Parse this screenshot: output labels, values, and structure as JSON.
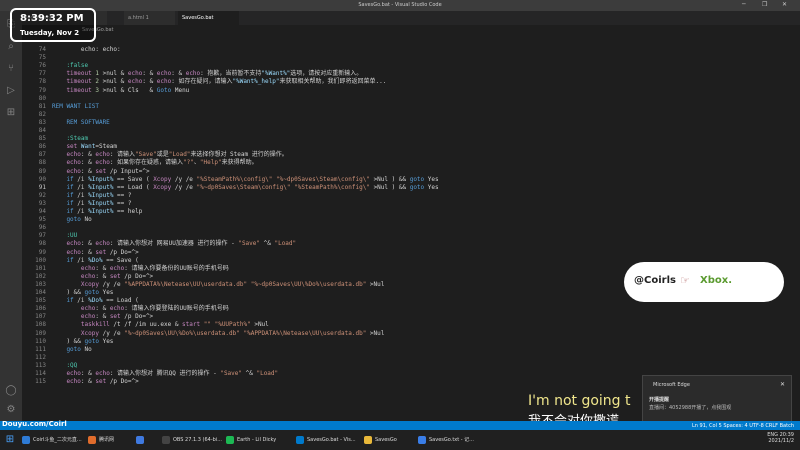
{
  "window": {
    "title": "SavesGo.bat - Visual Studio Code",
    "controls": [
      "─",
      "❐",
      "✕"
    ]
  },
  "tabs": [
    {
      "label": "login.html"
    },
    {
      "label": "a.html 1"
    },
    {
      "label": "SavesGo.bat",
      "active": true
    }
  ],
  "breadcrumb": "SavesGo.bat",
  "activity_icons": [
    "files-icon",
    "search-icon",
    "source-control-icon",
    "run-debug-icon",
    "extensions-icon"
  ],
  "activity_glyphs": [
    "⎘",
    "⌕",
    "⑂",
    "▷",
    "⊞"
  ],
  "bottom_icons": [
    "account-icon",
    "settings-gear-icon"
  ],
  "bottom_glyphs": [
    "◯",
    "⚙"
  ],
  "lines": [
    {
      "n": "74",
      "parts": [
        [
          "txt",
          "        echo: echo:"
        ]
      ]
    },
    {
      "n": "75",
      "parts": []
    },
    {
      "n": "76",
      "parts": [
        [
          "lbl",
          "    :false"
        ]
      ]
    },
    {
      "n": "77",
      "parts": [
        [
          "cmd",
          "    timeout "
        ],
        [
          "num",
          "1"
        ],
        [
          "txt",
          " >nul & "
        ],
        [
          "cmd",
          "echo"
        ],
        [
          "txt",
          ": & "
        ],
        [
          "cmd",
          "echo"
        ],
        [
          "txt",
          ": & "
        ],
        [
          "cmd",
          "echo"
        ],
        [
          "txt",
          ": 抱歉，当前暂不支持"
        ],
        [
          "var",
          "\"%Want%\""
        ],
        [
          "txt",
          "选项，请按对应重新输入。"
        ]
      ]
    },
    {
      "n": "78",
      "parts": [
        [
          "cmd",
          "    timeout "
        ],
        [
          "num",
          "2"
        ],
        [
          "txt",
          " >nul & "
        ],
        [
          "cmd",
          "echo"
        ],
        [
          "txt",
          ": & "
        ],
        [
          "cmd",
          "echo"
        ],
        [
          "txt",
          ": 如存在疑问，请输入"
        ],
        [
          "var",
          "\"%Want%_help\""
        ],
        [
          "txt",
          "来获取相关帮助，我们即将返回菜单..."
        ]
      ]
    },
    {
      "n": "79",
      "parts": [
        [
          "cmd",
          "    timeout "
        ],
        [
          "num",
          "3"
        ],
        [
          "txt",
          " >nul & Cls   & "
        ],
        [
          "kw",
          "Goto"
        ],
        [
          "txt",
          " Menu"
        ]
      ]
    },
    {
      "n": "80",
      "parts": []
    },
    {
      "n": "81",
      "parts": [
        [
          "kw",
          "REM WANT LIST"
        ]
      ]
    },
    {
      "n": "82",
      "parts": []
    },
    {
      "n": "83",
      "parts": [
        [
          "kw",
          "    REM SOFTWARE"
        ]
      ]
    },
    {
      "n": "84",
      "parts": []
    },
    {
      "n": "85",
      "parts": [
        [
          "lbl",
          "    :Steam"
        ]
      ]
    },
    {
      "n": "86",
      "parts": [
        [
          "cmd",
          "    set "
        ],
        [
          "var",
          "Want"
        ],
        [
          "txt",
          "=Steam"
        ]
      ]
    },
    {
      "n": "87",
      "parts": [
        [
          "cmd",
          "    echo"
        ],
        [
          "txt",
          ": & "
        ],
        [
          "cmd",
          "echo"
        ],
        [
          "txt",
          ": 请输入"
        ],
        [
          "str",
          "\"Save\""
        ],
        [
          "txt",
          "或是"
        ],
        [
          "str",
          "\"Load\""
        ],
        [
          "txt",
          "来选择你想对 Steam 进行的操作。"
        ]
      ]
    },
    {
      "n": "88",
      "parts": [
        [
          "cmd",
          "    echo"
        ],
        [
          "txt",
          ": & "
        ],
        [
          "cmd",
          "echo"
        ],
        [
          "txt",
          ": 如果你存在疑惑，请输入"
        ],
        [
          "str",
          "\"?\""
        ],
        [
          "txt",
          "、"
        ],
        [
          "str",
          "\"Help\""
        ],
        [
          "txt",
          "来获得帮助。"
        ]
      ]
    },
    {
      "n": "89",
      "parts": [
        [
          "cmd",
          "    echo"
        ],
        [
          "txt",
          ": & "
        ],
        [
          "cmd",
          "set"
        ],
        [
          "txt",
          " /p Input=^>"
        ]
      ]
    },
    {
      "n": "90",
      "parts": [
        [
          "kw",
          "    if"
        ],
        [
          "txt",
          " /i "
        ],
        [
          "var",
          "%Input%"
        ],
        [
          "txt",
          " == Save ( "
        ],
        [
          "cmd",
          "Xcopy"
        ],
        [
          "txt",
          " /y /e "
        ],
        [
          "str",
          "\"%SteamPath%\\config\\\""
        ],
        [
          "txt",
          " "
        ],
        [
          "str",
          "\"%~dp0Saves\\Steam\\config\\\""
        ],
        [
          "txt",
          " >Nul ) && "
        ],
        [
          "kw",
          "goto"
        ],
        [
          "txt",
          " Yes"
        ]
      ]
    },
    {
      "n": "91",
      "parts": [
        [
          "kw",
          "    if"
        ],
        [
          "txt",
          " /i "
        ],
        [
          "var",
          "%Input%"
        ],
        [
          "txt",
          " == Load ( "
        ],
        [
          "cmd",
          "Xcopy"
        ],
        [
          "txt",
          " /y /e "
        ],
        [
          "str",
          "\"%~dp0Saves\\Steam\\config\\\""
        ],
        [
          "txt",
          " "
        ],
        [
          "str",
          "\"%SteamPath%\\config\\\""
        ],
        [
          "txt",
          " >Nul ) && "
        ],
        [
          "kw",
          "goto"
        ],
        [
          "txt",
          " Yes"
        ]
      ]
    },
    {
      "n": "92",
      "parts": [
        [
          "kw",
          "    if"
        ],
        [
          "txt",
          " /i "
        ],
        [
          "var",
          "%Input%"
        ],
        [
          "txt",
          " == ?"
        ]
      ]
    },
    {
      "n": "93",
      "parts": [
        [
          "kw",
          "    if"
        ],
        [
          "txt",
          " /i "
        ],
        [
          "var",
          "%Input%"
        ],
        [
          "txt",
          " == ?"
        ]
      ]
    },
    {
      "n": "94",
      "parts": [
        [
          "kw",
          "    if"
        ],
        [
          "txt",
          " /i "
        ],
        [
          "var",
          "%Input%"
        ],
        [
          "txt",
          " == help"
        ]
      ]
    },
    {
      "n": "95",
      "parts": [
        [
          "kw",
          "    goto"
        ],
        [
          "txt",
          " No"
        ]
      ]
    },
    {
      "n": "96",
      "parts": []
    },
    {
      "n": "97",
      "parts": [
        [
          "lbl",
          "    :UU"
        ]
      ]
    },
    {
      "n": "98",
      "parts": [
        [
          "cmd",
          "    echo"
        ],
        [
          "txt",
          ": & "
        ],
        [
          "cmd",
          "echo"
        ],
        [
          "txt",
          ": 请输入你想对 网易UU加速器 进行的操作 - "
        ],
        [
          "str",
          "\"Save\""
        ],
        [
          "txt",
          " ^& "
        ],
        [
          "str",
          "\"Load\""
        ]
      ]
    },
    {
      "n": "99",
      "parts": [
        [
          "cmd",
          "    echo"
        ],
        [
          "txt",
          ": & "
        ],
        [
          "cmd",
          "set"
        ],
        [
          "txt",
          " /p Do=^>"
        ]
      ]
    },
    {
      "n": "100",
      "parts": [
        [
          "kw",
          "    if"
        ],
        [
          "txt",
          " /i "
        ],
        [
          "var",
          "%Do%"
        ],
        [
          "txt",
          " == Save ("
        ]
      ]
    },
    {
      "n": "101",
      "parts": [
        [
          "cmd",
          "        echo"
        ],
        [
          "txt",
          ": & "
        ],
        [
          "cmd",
          "echo"
        ],
        [
          "txt",
          ": 请输入你要备份的UU账号的手机号码"
        ]
      ]
    },
    {
      "n": "102",
      "parts": [
        [
          "cmd",
          "        echo"
        ],
        [
          "txt",
          ": & "
        ],
        [
          "cmd",
          "set"
        ],
        [
          "txt",
          " /p Do=^>"
        ]
      ]
    },
    {
      "n": "103",
      "parts": [
        [
          "cmd",
          "        Xcopy"
        ],
        [
          "txt",
          " /y /e "
        ],
        [
          "str",
          "\"%APPDATA%\\Netease\\UU\\userdata.db\""
        ],
        [
          "txt",
          " "
        ],
        [
          "str",
          "\"%~dp0Saves\\UU\\%Do%\\userdata.db\""
        ],
        [
          "txt",
          " >Nul"
        ]
      ]
    },
    {
      "n": "104",
      "parts": [
        [
          "txt",
          "    ) && "
        ],
        [
          "kw",
          "goto"
        ],
        [
          "txt",
          " Yes"
        ]
      ]
    },
    {
      "n": "105",
      "parts": [
        [
          "kw",
          "    if"
        ],
        [
          "txt",
          " /i "
        ],
        [
          "var",
          "%Do%"
        ],
        [
          "txt",
          " == Load ("
        ]
      ]
    },
    {
      "n": "106",
      "parts": [
        [
          "cmd",
          "        echo"
        ],
        [
          "txt",
          ": & "
        ],
        [
          "cmd",
          "echo"
        ],
        [
          "txt",
          ": 请输入你要登陆的UU账号的手机号码"
        ]
      ]
    },
    {
      "n": "107",
      "parts": [
        [
          "cmd",
          "        echo"
        ],
        [
          "txt",
          ": & "
        ],
        [
          "cmd",
          "set"
        ],
        [
          "txt",
          " /p Do=^>"
        ]
      ]
    },
    {
      "n": "108",
      "parts": [
        [
          "cmd",
          "        taskkill"
        ],
        [
          "txt",
          " /t /f /im uu.exe & "
        ],
        [
          "cmd",
          "start"
        ],
        [
          "txt",
          " "
        ],
        [
          "str",
          "\"\""
        ],
        [
          "txt",
          " "
        ],
        [
          "str",
          "\"%UUPath%\""
        ],
        [
          "txt",
          " >Nul"
        ]
      ]
    },
    {
      "n": "109",
      "parts": [
        [
          "cmd",
          "        Xcopy"
        ],
        [
          "txt",
          " /y /e "
        ],
        [
          "str",
          "\"%~dp0Saves\\UU\\%Do%\\userdata.db\""
        ],
        [
          "txt",
          " "
        ],
        [
          "str",
          "\"%APPDATA%\\Netease\\UU\\userdata.db\""
        ],
        [
          "txt",
          " >Nul"
        ]
      ]
    },
    {
      "n": "110",
      "parts": [
        [
          "txt",
          "    ) && "
        ],
        [
          "kw",
          "goto"
        ],
        [
          "txt",
          " Yes"
        ]
      ]
    },
    {
      "n": "111",
      "parts": [
        [
          "kw",
          "    goto"
        ],
        [
          "txt",
          " No"
        ]
      ]
    },
    {
      "n": "112",
      "parts": []
    },
    {
      "n": "113",
      "parts": [
        [
          "lbl",
          "    :QQ"
        ]
      ]
    },
    {
      "n": "114",
      "parts": [
        [
          "cmd",
          "    echo"
        ],
        [
          "txt",
          ": & "
        ],
        [
          "cmd",
          "echo"
        ],
        [
          "txt",
          ": 请输入你想对 腾讯QQ 进行的操作 - "
        ],
        [
          "str",
          "\"Save\""
        ],
        [
          "txt",
          " ^& "
        ],
        [
          "str",
          "\"Load\""
        ]
      ]
    },
    {
      "n": "115",
      "parts": [
        [
          "cmd",
          "    echo"
        ],
        [
          "txt",
          ": & "
        ],
        [
          "cmd",
          "set"
        ],
        [
          "txt",
          " /p Do=^>"
        ]
      ]
    }
  ],
  "current_line": "91",
  "overlay": {
    "clock_time": "8:39:32 PM",
    "clock_date": "Tuesday, Nov 2",
    "badge_left": "@Coirls",
    "badge_hand": "☞",
    "badge_right": "Xbox.",
    "subtitle_en": "I'm not going t",
    "subtitle_zh": "我不会对你撒谎",
    "watermark": "Douyu.com/Coirl"
  },
  "notification": {
    "app": "Microsoft Edge",
    "title": "开播提醒",
    "body": "直播间：4052988开播了，点我围观",
    "close": "✕"
  },
  "statusbar": {
    "right": "Ln 91, Col 5   Spaces: 4   UTF-8   CRLF   Batch"
  },
  "taskbar": {
    "start_glyph": "⊞",
    "items": [
      {
        "label": "Coirl斗鱼_二次元直...",
        "color": "#2e7bd6"
      },
      {
        "label": "腾讯网",
        "color": "#e06c2c"
      },
      {
        "label": "",
        "color": "#3f7ae0"
      },
      {
        "label": "OBS 27.1.3 (64-bi...",
        "color": "#444"
      },
      {
        "label": "Earth - Lil Dicky",
        "color": "#1db954"
      },
      {
        "label": "SavesGo.bat - Vis...",
        "color": "#007acc"
      },
      {
        "label": "SavesGo",
        "color": "#e8b83a"
      },
      {
        "label": "SavesGo.txt - 记...",
        "color": "#3a7ee8"
      }
    ],
    "tray_lang": "ENG",
    "tray_time": "20:39",
    "tray_date": "2021/11/2"
  }
}
